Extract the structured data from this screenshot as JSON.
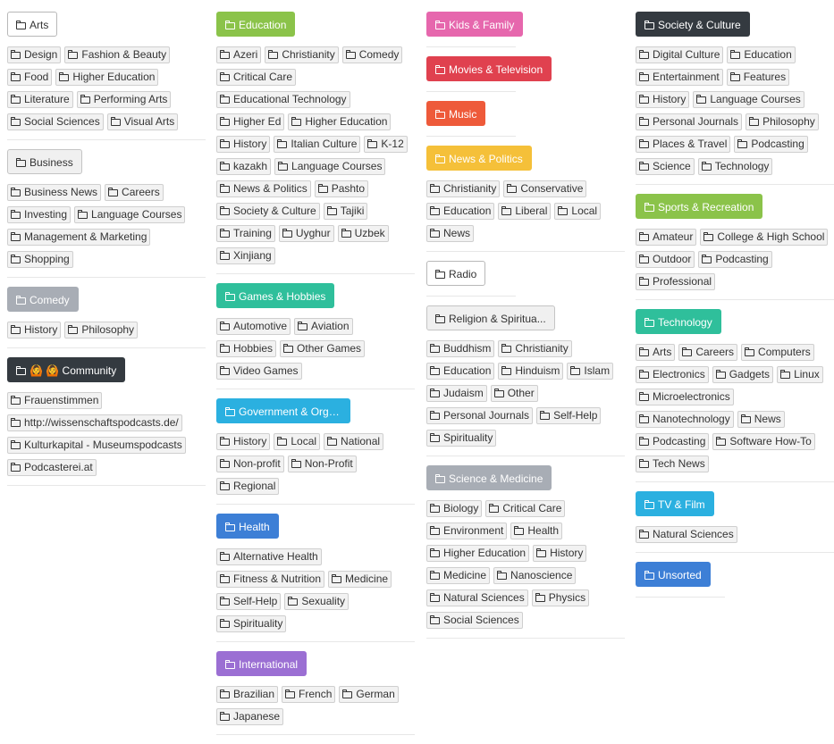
{
  "columns": [
    {
      "sections": [
        {
          "title": "Arts",
          "style": "outline",
          "color": "",
          "tags": [
            "Design",
            "Fashion & Beauty",
            "Food",
            "Higher Education",
            "Literature",
            "Performing Arts",
            "Social Sciences",
            "Visual Arts"
          ]
        },
        {
          "title": "Business",
          "style": "light",
          "color": "",
          "tags": [
            "Business News",
            "Careers",
            "Investing",
            "Language Courses",
            "Management & Marketing",
            "Shopping"
          ]
        },
        {
          "title": "Comedy",
          "style": "filled",
          "color": "#a8adb5",
          "tags": [
            "History",
            "Philosophy"
          ]
        },
        {
          "title": "🙆 🙆 Community",
          "style": "filled",
          "color": "#343a40",
          "tags": [
            "Frauenstimmen",
            "http://wissenschaftspodcasts.de/",
            "Kulturkapital - Museumspodcasts",
            "Podcasterei.at"
          ]
        }
      ]
    },
    {
      "sections": [
        {
          "title": "Education",
          "style": "filled",
          "color": "#8bc34a",
          "tags": [
            "Azeri",
            "Christianity",
            "Comedy",
            "Critical Care",
            "Educational Technology",
            "Higher Ed",
            "Higher Education",
            "History",
            "Italian Culture",
            "K-12",
            "kazakh",
            "Language Courses",
            "News & Politics",
            "Pashto",
            "Society & Culture",
            "Tajiki",
            "Training",
            "Uyghur",
            "Uzbek",
            "Xinjiang"
          ]
        },
        {
          "title": "Games & Hobbies",
          "style": "filled",
          "color": "#2fbf9b",
          "tags": [
            "Automotive",
            "Aviation",
            "Hobbies",
            "Other Games",
            "Video Games"
          ]
        },
        {
          "title": "Government & Organi...",
          "style": "filled",
          "color": "#2bb0e0",
          "tags": [
            "History",
            "Local",
            "National",
            "Non-profit",
            "Non-Profit",
            "Regional"
          ]
        },
        {
          "title": "Health",
          "style": "filled",
          "color": "#3d7fd6",
          "tags": [
            "Alternative Health",
            "Fitness & Nutrition",
            "Medicine",
            "Self-Help",
            "Sexuality",
            "Spirituality"
          ]
        },
        {
          "title": "International",
          "style": "filled",
          "color": "#9b6fd3",
          "tags": [
            "Brazilian",
            "French",
            "German",
            "Japanese"
          ]
        }
      ]
    },
    {
      "sections": [
        {
          "title": "Kids & Family",
          "style": "filled",
          "color": "#e667ad",
          "tags": []
        },
        {
          "title": "Movies & Television",
          "style": "filled",
          "color": "#e0414f",
          "tags": []
        },
        {
          "title": "Music",
          "style": "filled",
          "color": "#ee5a3a",
          "tags": []
        },
        {
          "title": "News & Politics",
          "style": "filled",
          "color": "#f5c039",
          "tags": [
            "Christianity",
            "Conservative",
            "Education",
            "Liberal",
            "Local",
            "News"
          ]
        },
        {
          "title": "Radio",
          "style": "outline",
          "color": "",
          "tags": []
        },
        {
          "title": "Religion & Spiritua...",
          "style": "light",
          "color": "",
          "tags": [
            "Buddhism",
            "Christianity",
            "Education",
            "Hinduism",
            "Islam",
            "Judaism",
            "Other",
            "Personal Journals",
            "Self-Help",
            "Spirituality"
          ]
        },
        {
          "title": "Science & Medicine",
          "style": "filled",
          "color": "#a8adb5",
          "tags": [
            "Biology",
            "Critical Care",
            "Environment",
            "Health",
            "Higher Education",
            "History",
            "Medicine",
            "Nanoscience",
            "Natural Sciences",
            "Physics",
            "Social Sciences"
          ]
        }
      ]
    },
    {
      "sections": [
        {
          "title": "Society & Culture",
          "style": "filled",
          "color": "#343a40",
          "tags": [
            "Digital Culture",
            "Education",
            "Entertainment",
            "Features",
            "History",
            "Language Courses",
            "Personal Journals",
            "Philosophy",
            "Places & Travel",
            "Podcasting",
            "Science",
            "Technology"
          ]
        },
        {
          "title": "Sports & Recreation",
          "style": "filled",
          "color": "#8bc34a",
          "tags": [
            "Amateur",
            "College & High School",
            "Outdoor",
            "Podcasting",
            "Professional"
          ]
        },
        {
          "title": "Technology",
          "style": "filled",
          "color": "#2fbf9b",
          "tags": [
            "Arts",
            "Careers",
            "Computers",
            "Electronics",
            "Gadgets",
            "Linux",
            "Microelectronics",
            "Nanotechnology",
            "News",
            "Podcasting",
            "Software How-To",
            "Tech News"
          ]
        },
        {
          "title": "TV & Film",
          "style": "filled",
          "color": "#2bb0e0",
          "tags": [
            "Natural Sciences"
          ]
        },
        {
          "title": "Unsorted",
          "style": "filled",
          "color": "#3d7fd6",
          "tags": []
        }
      ]
    }
  ]
}
